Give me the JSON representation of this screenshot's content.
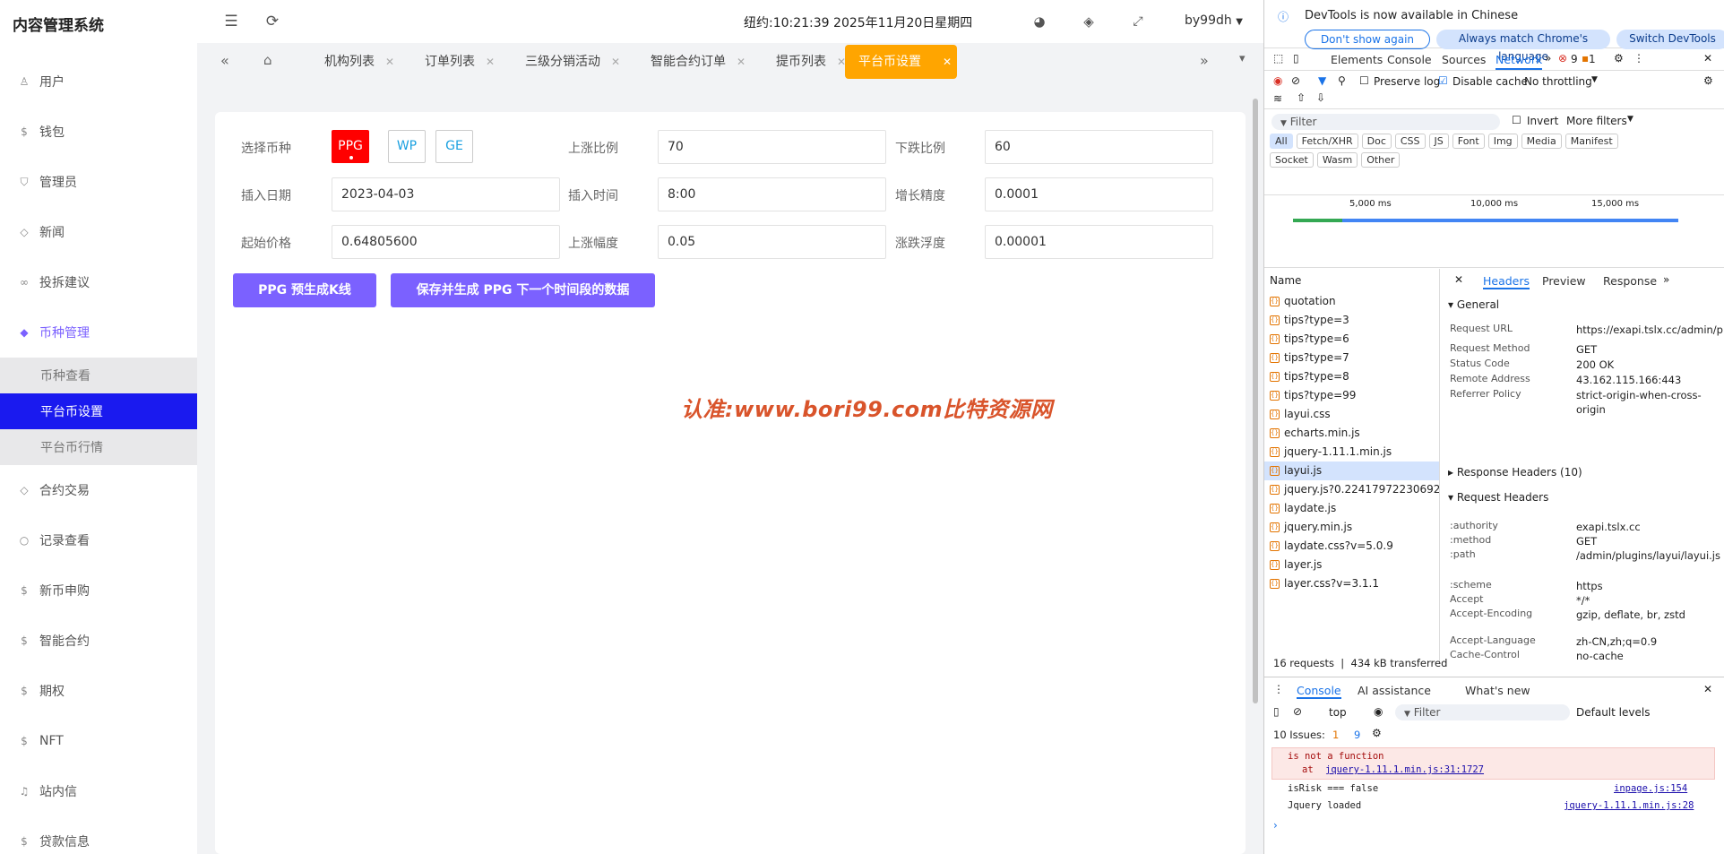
{
  "app": {
    "title": "内容管理系统",
    "clock": "纽约:10:21:39 2025年11月20日星期四",
    "user": "by99dh"
  },
  "sidebar": {
    "items": [
      {
        "label": "用户",
        "icon": "user-icon"
      },
      {
        "label": "钱包",
        "icon": "dollar-icon"
      },
      {
        "label": "管理员",
        "icon": "shield-icon"
      },
      {
        "label": "新闻",
        "icon": "tag-icon"
      },
      {
        "label": "投拆建议",
        "icon": "link-icon"
      },
      {
        "label": "币种管理",
        "icon": "diamond-icon"
      }
    ],
    "sub_items": [
      {
        "label": "币种查看"
      },
      {
        "label": "平台币设置"
      },
      {
        "label": "平台币行情"
      }
    ],
    "items_after": [
      {
        "label": "合约交易",
        "icon": "diamond-icon"
      },
      {
        "label": "记录查看",
        "icon": "circle-icon"
      },
      {
        "label": "新币申购",
        "icon": "dollar-icon"
      },
      {
        "label": "智能合约",
        "icon": "dollar-icon"
      },
      {
        "label": "期权",
        "icon": "dollar-icon"
      },
      {
        "label": "NFT",
        "icon": "dollar-icon"
      },
      {
        "label": "站内信",
        "icon": "bell-icon"
      },
      {
        "label": "贷款信息",
        "icon": "dollar-icon"
      }
    ]
  },
  "tabs": [
    {
      "label": "机构列表"
    },
    {
      "label": "订单列表"
    },
    {
      "label": "三级分销活动"
    },
    {
      "label": "智能合约订单"
    },
    {
      "label": "提币列表"
    },
    {
      "label": "平台币设置",
      "active": true
    }
  ],
  "form": {
    "coin_label": "选择币种",
    "coins": [
      "PPG",
      "WP",
      "GE"
    ],
    "selected_coin": "PPG",
    "rise_ratio_label": "上涨比例",
    "rise_ratio": "70",
    "fall_ratio_label": "下跌比例",
    "fall_ratio": "60",
    "insert_date_label": "插入日期",
    "insert_date": "2023-04-03",
    "insert_time_label": "插入时间",
    "insert_time": "8:00",
    "growth_precision_label": "增长精度",
    "growth_precision": "0.0001",
    "start_price_label": "起始价格",
    "start_price": "0.64805600",
    "rise_range_label": "上涨幅度",
    "rise_range": "0.05",
    "fluctuation_label": "涨跌浮度",
    "fluctuation": "0.00001",
    "btn_generate": "PPG 预生成K线",
    "btn_save": "保存并生成 PPG 下一个时间段的数据"
  },
  "watermark": "认准:www.bori99.com比特资源网",
  "devtools": {
    "banner": "DevTools is now available in Chinese",
    "banner_btn1": "Don't show again",
    "banner_btn2": "Always match Chrome's language",
    "banner_btn3": "Switch DevTools",
    "tabs": [
      "Elements",
      "Console",
      "Sources",
      "Network"
    ],
    "errors": "9",
    "warnings": "1",
    "preserve_log": "Preserve log",
    "disable_cache": "Disable cache",
    "throttling": "No throttling",
    "filter_placeholder": "Filter",
    "invert": "Invert",
    "more_filters": "More filters",
    "filter_types": [
      "All",
      "Fetch/XHR",
      "Doc",
      "CSS",
      "JS",
      "Font",
      "Img",
      "Media",
      "Manifest",
      "Socket",
      "Wasm",
      "Other"
    ],
    "timeline": [
      "5,000 ms",
      "10,000 ms",
      "15,000 ms"
    ],
    "name_header": "Name",
    "requests": [
      "quotation",
      "tips?type=3",
      "tips?type=6",
      "tips?type=7",
      "tips?type=8",
      "tips?type=99",
      "layui.css",
      "echarts.min.js",
      "jquery-1.11.1.min.js",
      "layui.js",
      "jquery.js?0.22417972230692...",
      "laydate.js",
      "jquery.min.js",
      "laydate.css?v=5.0.9",
      "layer.js",
      "layer.css?v=3.1.1"
    ],
    "detail_tabs": [
      "Headers",
      "Preview",
      "Response"
    ],
    "general_title": "General",
    "general": [
      {
        "k": "Request URL",
        "v": "https://exapi.tslx.cc/admin/plugins/layui/layui.js"
      },
      {
        "k": "Request Method",
        "v": "GET"
      },
      {
        "k": "Status Code",
        "v": "200 OK"
      },
      {
        "k": "Remote Address",
        "v": "43.162.115.166:443"
      },
      {
        "k": "Referrer Policy",
        "v": "strict-origin-when-cross-origin"
      }
    ],
    "response_headers": "Response Headers (10)",
    "request_headers_title": "Request Headers",
    "request_headers": [
      {
        "k": ":authority",
        "v": "exapi.tslx.cc"
      },
      {
        "k": ":method",
        "v": "GET"
      },
      {
        "k": ":path",
        "v": "/admin/plugins/layui/layui.js"
      },
      {
        "k": ":scheme",
        "v": "https"
      },
      {
        "k": "Accept",
        "v": "*/*"
      },
      {
        "k": "Accept-Encoding",
        "v": "gzip, deflate, br, zstd"
      },
      {
        "k": "Accept-Language",
        "v": "zh-CN,zh;q=0.9"
      },
      {
        "k": "Cache-Control",
        "v": "no-cache"
      }
    ],
    "summary_requests": "16 requests",
    "summary_transferred": "434 kB transferred",
    "drawer_tabs": [
      "Console",
      "AI assistance",
      "What's new"
    ],
    "context": "top",
    "console_filter": "Filter",
    "levels": "Default levels",
    "issues": "10 Issues:",
    "issues_warn": "1",
    "issues_info": "9",
    "console_lines": {
      "err1": "is not a function",
      "err2": "at ",
      "err2_link": "jquery-1.11.1.min.js:31:1727",
      "log1": "isRisk ===  false",
      "log1_src": "inpage.js:154",
      "log2": "Jquery loaded",
      "log2_src": "jquery-1.11.1.min.js:28"
    }
  }
}
